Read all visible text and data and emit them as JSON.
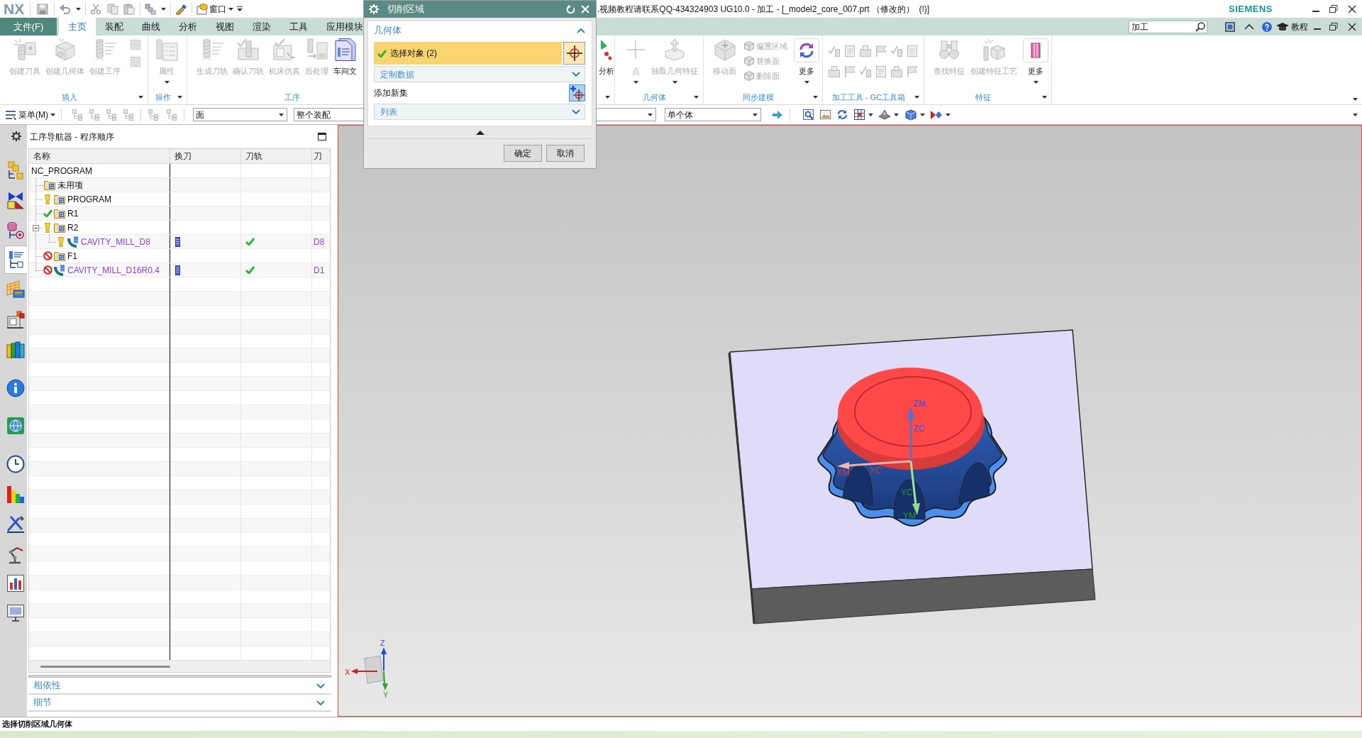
{
  "title_bar": {
    "logo": "NX",
    "window_menu": "窗口",
    "title": ".视频教程请联系QQ-434324903 UG10.0 - 加工 - [_model2_core_007.prt （修改的）  (!)]",
    "brand": "SIEMENS"
  },
  "ribbon_tabs": [
    {
      "label": "文件(F)",
      "kind": "file",
      "selected": false
    },
    {
      "label": "主页",
      "kind": "tab",
      "selected": true
    },
    {
      "label": "装配",
      "kind": "tab",
      "selected": false
    },
    {
      "label": "曲线",
      "kind": "tab",
      "selected": false
    },
    {
      "label": "分析",
      "kind": "tab",
      "selected": false
    },
    {
      "label": "视图",
      "kind": "tab",
      "selected": false
    },
    {
      "label": "渲染",
      "kind": "tab",
      "selected": false
    },
    {
      "label": "工具",
      "kind": "tab",
      "selected": false
    },
    {
      "label": "应用模块",
      "kind": "tab",
      "selected": false
    }
  ],
  "command_search": {
    "value": "加工"
  },
  "help_menu": "教程",
  "ribbon_left": [
    {
      "label": "插入",
      "menu": true,
      "items": [
        {
          "kind": "large",
          "label": "创建刀具",
          "disabled": true,
          "dropdown": false
        },
        {
          "kind": "large",
          "label": "创建几何体",
          "disabled": true,
          "dropdown": false
        },
        {
          "kind": "large",
          "label": "创建工序",
          "disabled": true,
          "dropdown": false
        },
        {
          "kind": "small",
          "disabled": true
        },
        {
          "kind": "small",
          "disabled": true
        }
      ]
    },
    {
      "label": "操作",
      "menu": true,
      "items": [
        {
          "kind": "large",
          "label": "属性",
          "disabled": true,
          "dropdown": true
        }
      ]
    },
    {
      "label": "工序",
      "menu": false,
      "items": [
        {
          "kind": "large",
          "label": "生成刀轨",
          "disabled": true,
          "dropdown": false
        },
        {
          "kind": "large",
          "label": "确认刀轨",
          "disabled": true,
          "dropdown": false
        },
        {
          "kind": "large",
          "label": "机床仿真",
          "disabled": true,
          "dropdown": false
        },
        {
          "kind": "large",
          "label": "后处理",
          "disabled": true,
          "dropdown": false
        },
        {
          "kind": "large",
          "label": "车间文",
          "disabled": false,
          "dropdown": false
        }
      ]
    }
  ],
  "ribbon_right": [
    {
      "menu": true,
      "items": [
        {
          "kind": "large",
          "label": "分析",
          "disabled": false,
          "dropdown": false
        }
      ]
    },
    {
      "label": "几何体",
      "menu": true,
      "items": [
        {
          "kind": "large",
          "label": "点",
          "disabled": true,
          "dropdown": true
        },
        {
          "kind": "large",
          "label": "抽取几何特征",
          "disabled": true,
          "dropdown": true
        }
      ]
    },
    {
      "label": "同步建模",
      "menu": true,
      "items": [
        {
          "kind": "large",
          "label": "移动面",
          "disabled": true,
          "dropdown": false
        },
        {
          "kind": "small",
          "label": "偏置区域",
          "disabled": true
        },
        {
          "kind": "small",
          "label": "替换面",
          "disabled": true
        },
        {
          "kind": "small",
          "label": "删除面",
          "disabled": true
        },
        {
          "kind": "more",
          "label": "更多",
          "disabled": false,
          "dropdown": true
        }
      ]
    },
    {
      "label": "加工工具 - GC工具箱",
      "menu": true,
      "items": [
        {
          "kind": "tiny",
          "disabled": true
        },
        {
          "kind": "tiny",
          "disabled": true
        },
        {
          "kind": "tiny",
          "disabled": true
        },
        {
          "kind": "tiny",
          "disabled": true
        },
        {
          "kind": "tiny",
          "disabled": true
        },
        {
          "kind": "tiny",
          "disabled": true
        },
        {
          "kind": "tiny",
          "disabled": true
        },
        {
          "kind": "tiny",
          "disabled": true
        },
        {
          "kind": "tiny",
          "disabled": true
        },
        {
          "kind": "tiny",
          "disabled": true
        },
        {
          "kind": "tiny",
          "disabled": true
        },
        {
          "kind": "tiny",
          "disabled": true
        }
      ]
    },
    {
      "label": "特征",
      "menu": true,
      "items": [
        {
          "kind": "large",
          "label": "查找特征",
          "disabled": true,
          "dropdown": false
        },
        {
          "kind": "large",
          "label": "创建特征工艺",
          "disabled": true,
          "dropdown": false
        },
        {
          "kind": "more",
          "label": "更多",
          "disabled": false,
          "dropdown": true
        }
      ]
    }
  ],
  "toolbar": {
    "menu": "菜单(M)",
    "selection_filter": "面",
    "scope_filter": "整个装配",
    "body_filter": "单个体"
  },
  "resource_bar": [
    {
      "selected": false
    },
    {
      "selected": false
    },
    {
      "selected": false
    },
    {
      "selected": true
    },
    {
      "selected": false
    },
    {
      "selected": false
    },
    {
      "selected": false
    },
    {
      "selected": false
    },
    {
      "selected": false
    },
    {
      "selected": false
    },
    {
      "selected": false
    },
    {
      "selected": false
    },
    {
      "selected": false
    },
    {
      "selected": false
    },
    {
      "selected": false
    }
  ],
  "navigator": {
    "title": "工序导航器 - 程序顺序",
    "columns": [
      "名称",
      "换刀",
      "刀轨",
      "刀"
    ],
    "root": {
      "name": "NC_PROGRAM",
      "children": [
        {
          "name": "未用项",
          "kind": "program",
          "complete": false,
          "pending": false,
          "excluded": false
        },
        {
          "name": "PROGRAM",
          "kind": "program",
          "complete": false,
          "pending": true,
          "excluded": false
        },
        {
          "name": "R1",
          "kind": "program",
          "complete": true,
          "pending": false,
          "excluded": false
        },
        {
          "name": "R2",
          "kind": "program",
          "complete": false,
          "pending": true,
          "excluded": false,
          "expanded": true,
          "children": [
            {
              "name": "CAVITY_MILL_D8",
              "kind": "operation",
              "complete": false,
              "pending": true,
              "excluded": false,
              "tool_change": true,
              "toolpath": true,
              "tool": "D8"
            }
          ]
        },
        {
          "name": "F1",
          "kind": "program",
          "complete": false,
          "pending": false,
          "excluded": true
        },
        {
          "name": "CAVITY_MILL_D16R0.4",
          "kind": "operation",
          "complete": false,
          "pending": false,
          "excluded": true,
          "tool_change": true,
          "toolpath": true,
          "tool": "D1"
        }
      ]
    },
    "panels": [
      {
        "label": "相依性",
        "expanded": false
      },
      {
        "label": "细节",
        "expanded": false
      }
    ]
  },
  "viewport": {
    "csys_labels": [
      "ZM",
      "ZC",
      "XM",
      "XC",
      "YC",
      "YM"
    ],
    "triad_labels": [
      "Z",
      "X",
      "Y"
    ]
  },
  "dialog": {
    "title": "切削区域",
    "sections": [
      {
        "title": "几何体",
        "expanded": true,
        "rows": [
          {
            "kind": "select",
            "label": "选择对象 (2)",
            "selected": true,
            "done": true
          },
          {
            "kind": "collapsible",
            "label": "定制数据",
            "expanded": false
          },
          {
            "kind": "add_set",
            "label": "添加新集"
          },
          {
            "kind": "collapsible",
            "label": "列表",
            "expanded": false
          }
        ]
      }
    ],
    "buttons": [
      "确定",
      "取消"
    ]
  },
  "status_bar": {
    "prompt": "选择切削区域几何体"
  }
}
